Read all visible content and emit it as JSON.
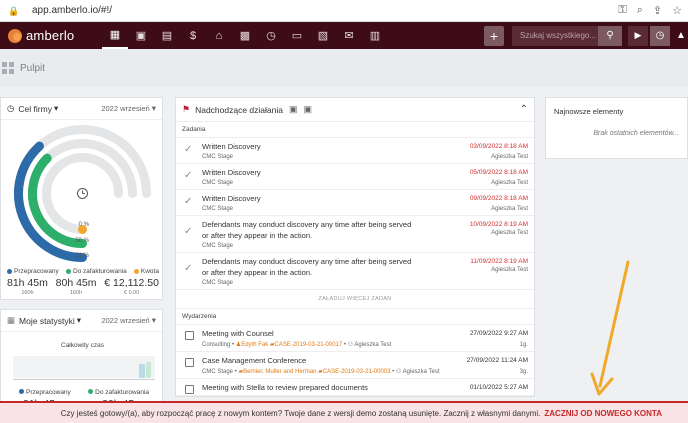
{
  "browser": {
    "url": "app.amberlo.io/#!/"
  },
  "app": {
    "logo_text": "amberlo"
  },
  "topbar": {
    "plus_label": "+",
    "search_placeholder": "Szukaj wszystkiego...",
    "nav_icons": [
      "dashboard-icon",
      "contacts-icon",
      "cases-icon",
      "documents-icon",
      "bank-icon",
      "calendar-icon",
      "time-icon",
      "folder-icon",
      "invoice-icon",
      "mail-icon",
      "reports-icon"
    ]
  },
  "page": {
    "title": "Pulpit"
  },
  "goal_card": {
    "title": "Cel firmy",
    "period": "2022 wrzesień",
    "percentages": [
      "0 %",
      "50 %",
      "51 %"
    ],
    "legend": [
      "Przepracowany",
      "Do zafakturowania",
      "Kwota"
    ],
    "values": [
      {
        "big": "81h 45m",
        "small": "160h"
      },
      {
        "big": "80h 45m",
        "small": "160h"
      },
      {
        "big": "€ 12,112.50",
        "small": "€ 0.00"
      }
    ],
    "colors": {
      "worked": "#2d6aa8",
      "billable": "#2eae6b",
      "amount": "#f4a52b"
    },
    "progress": {
      "worked": 0.51,
      "billable": 0.5,
      "amount": 0
    }
  },
  "stats_card": {
    "title": "Moje statystyki",
    "period": "2022 wrzesień",
    "total_label": "Całkowity czas",
    "legend": [
      "Przepracowany",
      "Do zafakturowania"
    ],
    "values": [
      "81h 45m",
      "80h 45m"
    ]
  },
  "actions_card": {
    "title": "Nadchodzące działania",
    "tasks_label": "Zadania",
    "tasks": [
      {
        "title": "Written Discovery",
        "stage": "CMC Stage",
        "date": "03/09/2022 8:18 AM",
        "who": "Agieszka Test"
      },
      {
        "title": "Written Discovery",
        "stage": "CMC Stage",
        "date": "05/09/2022 8:18 AM",
        "who": "Agieszka Test"
      },
      {
        "title": "Written Discovery",
        "stage": "CMC Stage",
        "date": "09/09/2022 8:18 AM",
        "who": "Agieszka Test"
      },
      {
        "title": "Defendants may conduct discovery any time after being served or after they appear in the action.",
        "stage": "CMC Stage",
        "date": "10/09/2022 8:19 AM",
        "who": "Agieszka Test"
      },
      {
        "title": "Defendants may conduct discovery any time after being served or after they appear in the action.",
        "stage": "CMC Stage",
        "date": "11/09/2022 8:19 AM",
        "who": "Agieszka Test"
      }
    ],
    "load_more": "ZAŁADUJ WIĘCEJ ZADAŃ",
    "events_label": "Wydarzenia",
    "events": [
      {
        "title": "Meeting with Counsel",
        "type": "Consulting",
        "client": "Edyth Fak",
        "case": "CASE-2019-03-21-00017",
        "who": "Agieszka Test",
        "date": "27/09/2022 9:27 AM",
        "duration": "1g."
      },
      {
        "title": "Case Management Conference",
        "type": "CMC Stage",
        "client": "Bernier, Muller and Herman",
        "case": "CASE-2019-03-21-00003",
        "who": "Agieszka Test",
        "date": "27/09/2022 11:24 AM",
        "duration": "3g."
      },
      {
        "title": "Meeting with Stella to review prepared documents",
        "type": "",
        "client": "",
        "case": "",
        "who": "",
        "date": "01/10/2022 5:27 AM",
        "duration": ""
      }
    ]
  },
  "latest_card": {
    "title": "Najnowsze elementy",
    "empty": "Brak ostatnich elementów..."
  },
  "banner": {
    "text": "Czy jesteś gotowy/(a), aby rozpocząć pracę z nowym kontem? Twoje dane z wersji demo zostaną usunięte. Zacznij z własnymi danymi.",
    "link": "ZACZNIJ OD NOWEGO KONTA"
  }
}
